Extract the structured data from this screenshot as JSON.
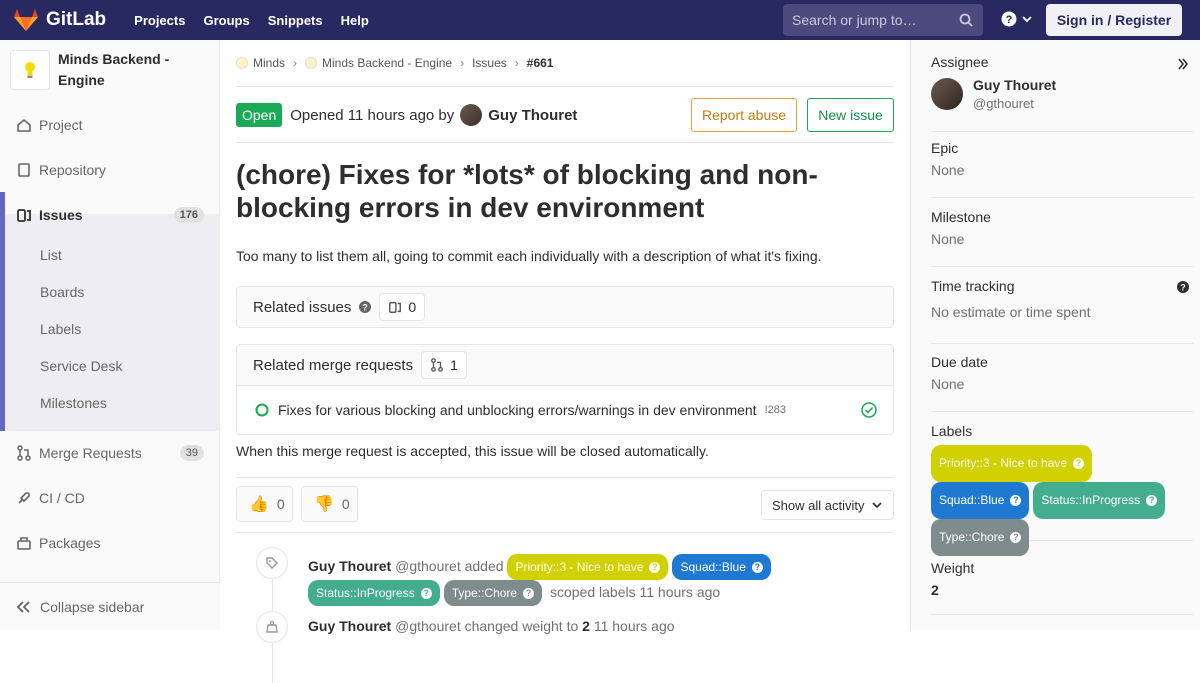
{
  "topbar": {
    "brand": "GitLab",
    "nav": [
      "Projects",
      "Groups",
      "Snippets",
      "Help"
    ],
    "search_placeholder": "Search or jump to…",
    "signin": "Sign in / Register"
  },
  "sidebar": {
    "project_name": "Minds Backend - Engine",
    "items": [
      {
        "label": "Project",
        "icon": "home-icon"
      },
      {
        "label": "Repository",
        "icon": "doc-icon"
      },
      {
        "label": "Issues",
        "icon": "issues-icon",
        "badge": "176"
      },
      {
        "label": "Merge Requests",
        "icon": "merge-icon",
        "badge": "39"
      },
      {
        "label": "CI / CD",
        "icon": "rocket-icon"
      },
      {
        "label": "Packages",
        "icon": "package-icon"
      }
    ],
    "issues_sub": [
      "List",
      "Boards",
      "Labels",
      "Service Desk",
      "Milestones"
    ],
    "collapse": "Collapse sidebar"
  },
  "breadcrumb": {
    "items": [
      "Minds",
      "Minds Backend - Engine",
      "Issues",
      "#661"
    ]
  },
  "issue": {
    "status": "Open",
    "opened_text": "Opened 11 hours ago by",
    "author": "Guy Thouret",
    "report_abuse": "Report abuse",
    "new_issue": "New issue",
    "title": "(chore) Fixes for *lots* of blocking and non-blocking errors in dev environment",
    "description": "Too many to list them all, going to commit each individually with a description of what it's fixing."
  },
  "related_issues": {
    "label": "Related issues",
    "count": "0"
  },
  "related_mrs": {
    "label": "Related merge requests",
    "count": "1",
    "mr_title": "Fixes for various blocking and unblocking errors/warnings in dev environment",
    "mr_ref": "!283",
    "note": "When this merge request is accepted, this issue will be closed automatically."
  },
  "awards": {
    "thumbsup": "0",
    "thumbsdown": "0"
  },
  "activity_filter": "Show all activity",
  "activity": [
    {
      "author": "Guy Thouret",
      "handle": "@gthouret",
      "action": "added",
      "suffix": "scoped labels 11 hours ago"
    },
    {
      "author": "Guy Thouret",
      "handle": "@gthouret",
      "action": "changed weight to",
      "value": "2",
      "suffix": "11 hours ago"
    }
  ],
  "labels": [
    {
      "text": "Priority::3 - Nice to have",
      "color": "#d1d100"
    },
    {
      "text": "Squad::Blue",
      "color": "#1f78d1"
    },
    {
      "text": "Status::InProgress",
      "color": "#44ad8e"
    },
    {
      "text": "Type::Chore",
      "color": "#7f8c8d"
    }
  ],
  "right_sidebar": {
    "assignee_label": "Assignee",
    "assignee_name": "Guy Thouret",
    "assignee_handle": "@gthouret",
    "epic_label": "Epic",
    "epic_value": "None",
    "milestone_label": "Milestone",
    "milestone_value": "None",
    "time_label": "Time tracking",
    "time_value": "No estimate or time spent",
    "due_label": "Due date",
    "due_value": "None",
    "labels_label": "Labels",
    "weight_label": "Weight",
    "weight_value": "2"
  }
}
